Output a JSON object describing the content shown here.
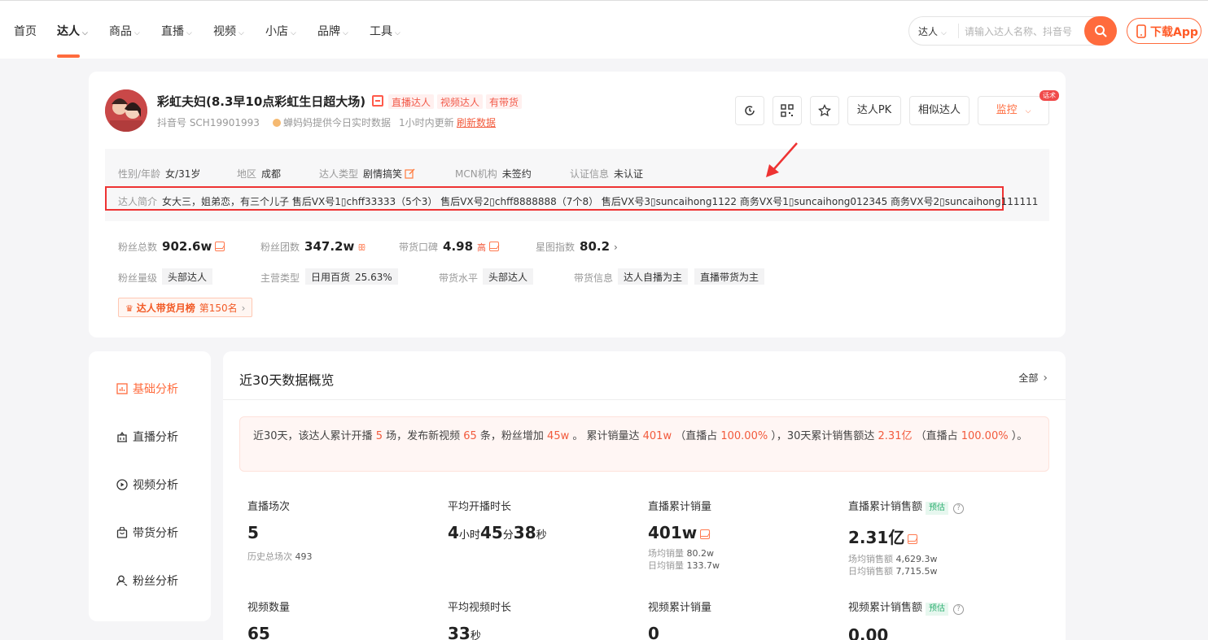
{
  "nav": {
    "items": [
      {
        "label": "首页",
        "caret": false
      },
      {
        "label": "达人",
        "caret": true,
        "active": true
      },
      {
        "label": "商品",
        "caret": true
      },
      {
        "label": "直播",
        "caret": true
      },
      {
        "label": "视频",
        "caret": true
      },
      {
        "label": "小店",
        "caret": true
      },
      {
        "label": "品牌",
        "caret": true
      },
      {
        "label": "工具",
        "caret": true
      }
    ],
    "search_type": "达人",
    "search_placeholder": "请输入达人名称、抖音号",
    "download_label": "下载App"
  },
  "profile": {
    "name": "彩虹夫妇(8.3早10点彩虹生日超大场)",
    "tags": [
      "直播达人",
      "视频达人",
      "有带货"
    ],
    "douyin_id": "抖音号 SCH19901993",
    "data_source": "蝉妈妈提供今日实时数据",
    "update_note": "1小时内更新",
    "refresh_label": "刷新数据",
    "actions": {
      "pk": "达人PK",
      "similar": "相似达人",
      "monitor": "监控",
      "hot_badge": "话术"
    },
    "info": {
      "gender_age_k": "性别/年龄",
      "gender_age_v": "女/31岁",
      "region_k": "地区",
      "region_v": "成都",
      "type_k": "达人类型",
      "type_v": "剧情搞笑",
      "mcn_k": "MCN机构",
      "mcn_v": "未签约",
      "cert_k": "认证信息",
      "cert_v": "未认证",
      "intro_k": "达人简介",
      "intro_v": "女大三，姐弟恋，有三个儿子 售后VX号1▯chff33333（5个3） 售后VX号2▯chff8888888（7个8） 售后VX号3▯suncaihong1122 商务VX号1▯suncaihong012345 商务VX号2▯suncaihong111111"
    },
    "metrics": {
      "fans_k": "粉丝总数",
      "fans_v": "902.6w",
      "fan_group_k": "粉丝团数",
      "fan_group_v": "347.2w",
      "reputation_k": "带货口碑",
      "reputation_v": "4.98",
      "reputation_level": "高",
      "star_k": "星图指数",
      "star_v": "80.2"
    },
    "levels": {
      "fan_level_k": "粉丝量级",
      "fan_level_v": "头部达人",
      "category_k": "主营类型",
      "category_v": "日用百货",
      "category_pct": "25.63%",
      "sales_level_k": "带货水平",
      "sales_level_v": "头部达人",
      "sales_info_k": "带货信息",
      "sales_info_v1": "达人自播为主",
      "sales_info_v2": "直播带货为主"
    },
    "rank": {
      "label": "达人带货月榜",
      "value": "第150名"
    }
  },
  "side_menu": [
    "基础分析",
    "直播分析",
    "视频分析",
    "带货分析",
    "粉丝分析"
  ],
  "overview": {
    "title": "近30天数据概览",
    "all_label": "全部",
    "summary": {
      "p1": "近30天，该达人累计开播 ",
      "live_count": "5",
      "p2": " 场，发布新视频 ",
      "video_count": "65",
      "p3": " 条，粉丝增加 ",
      "fans_inc": "45w",
      "p4": " 。 累计销量达 ",
      "sales": "401w",
      "p5": " （直播占 ",
      "live_pct": "100.00%",
      "p6": " ），30天累计销售额达 ",
      "gmv": "2.31亿",
      "p7": " （直播占 ",
      "gmv_pct": "100.00%",
      "p8": " ）。"
    },
    "stats": {
      "live_sessions_t": "直播场次",
      "live_sessions_v": "5",
      "live_sessions_sub_k": "历史总场次",
      "live_sessions_sub_v": "493",
      "avg_live_t": "平均开播时长",
      "avg_live_h": "4",
      "avg_live_hu": "小时",
      "avg_live_m": "45",
      "avg_live_mu": "分",
      "avg_live_s": "38",
      "avg_live_su": "秒",
      "live_sales_t": "直播累计销量",
      "live_sales_v": "401w",
      "live_sales_sub1_k": "场均销量",
      "live_sales_sub1_v": "80.2w",
      "live_sales_sub2_k": "日均销量",
      "live_sales_sub2_v": "133.7w",
      "live_gmv_t": "直播累计销售额",
      "est": "预估",
      "live_gmv_v": "2.31亿",
      "live_gmv_sub1_k": "场均销售额",
      "live_gmv_sub1_v": "4,629.3w",
      "live_gmv_sub2_k": "日均销售额",
      "live_gmv_sub2_v": "7,715.5w",
      "video_count_t": "视频数量",
      "video_count_v": "65",
      "avg_video_t": "平均视频时长",
      "avg_video_v": "33",
      "avg_video_u": "秒",
      "video_sales_t": "视频累计销量",
      "video_sales_v": "0",
      "video_gmv_t": "视频累计销售额",
      "video_gmv_v": "0.00"
    }
  },
  "colors": {
    "accent": "#ff6b3d",
    "highlight_border": "#e33333",
    "tag_bg": "#fff0ef"
  }
}
